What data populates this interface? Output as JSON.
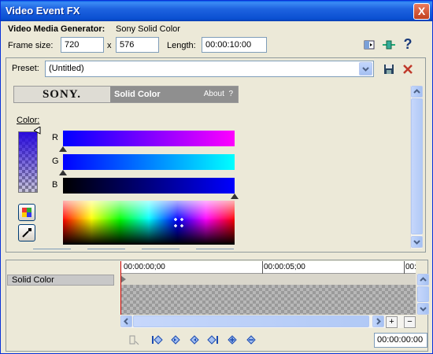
{
  "window": {
    "title": "Video Event FX",
    "close_glyph": "X"
  },
  "generator": {
    "label": "Video Media Generator:",
    "name": "Sony Solid Color"
  },
  "frame": {
    "label": "Frame size:",
    "width": "720",
    "x_sep": "x",
    "height": "576"
  },
  "length": {
    "label": "Length:",
    "value": "00:00:10:00"
  },
  "toolbar_icons": [
    "split-screen-preview-icon",
    "plugin-chain-icon",
    "help-icon"
  ],
  "help_glyph": "?",
  "preset": {
    "label": "Preset:",
    "value": "(Untitled)",
    "save_icon": "save-preset-icon",
    "delete_icon": "delete-preset-icon"
  },
  "plugin": {
    "brand": "SONY.",
    "title": "Solid Color",
    "about": "About",
    "about_q": "?"
  },
  "color": {
    "label": "Color:",
    "channels": [
      "R",
      "G",
      "B"
    ],
    "r": 0.0,
    "g": 0.0,
    "b": 1.0
  },
  "colors": {
    "accent": "#0831d9",
    "selected_color": "#2a0ad8"
  },
  "timeline": {
    "track_name": "Solid Color",
    "ticks": [
      "00:00:00;00",
      "00:00:05;00",
      "00:"
    ],
    "zoom_in": "+",
    "zoom_out": "−",
    "transport_icons": [
      "sync-cursor-icon",
      "first-keyframe-icon",
      "prev-keyframe-icon",
      "next-keyframe-icon",
      "last-keyframe-icon",
      "add-keyframe-icon",
      "delete-keyframe-icon"
    ],
    "time": "00:00:00:00"
  }
}
